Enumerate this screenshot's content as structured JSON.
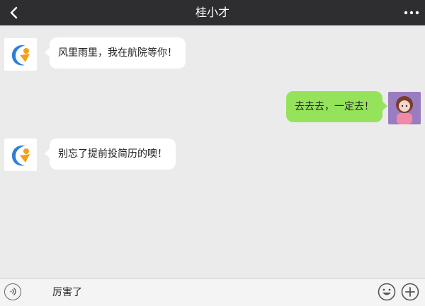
{
  "header": {
    "title": "桂小才"
  },
  "messages": [
    {
      "from": "bot",
      "text": "风里雨里，我在航院等你！"
    },
    {
      "from": "me",
      "text": "去去去，一定去！"
    },
    {
      "from": "bot",
      "text": "别忘了提前投简历的噢！"
    }
  ],
  "input": {
    "value": "厉害了"
  },
  "icons": {
    "back": "chevron-left-icon",
    "more": "more-dots-icon",
    "voice": "voice-icon",
    "emoji": "emoji-icon",
    "add": "plus-icon"
  },
  "colors": {
    "header_bg": "#2e2e31",
    "chat_bg": "#ebebeb",
    "my_bubble": "#95e35a",
    "other_bubble": "#ffffff"
  }
}
